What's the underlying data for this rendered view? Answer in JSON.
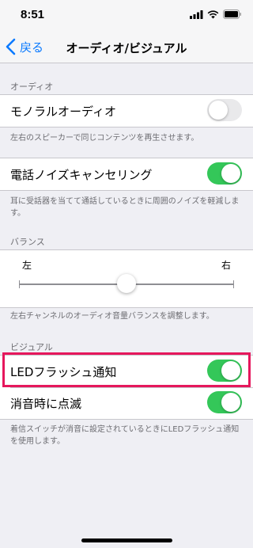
{
  "status_bar": {
    "time": "8:51"
  },
  "nav": {
    "back_label": "戻る",
    "title": "オーディオ/ビジュアル"
  },
  "sections": {
    "audio": {
      "header": "オーディオ",
      "mono_label": "モノラルオーディオ",
      "mono_enabled": false,
      "mono_footer": "左右のスピーカーで同じコンテンツを再生させます。",
      "noise_label": "電話ノイズキャンセリング",
      "noise_enabled": true,
      "noise_footer": "耳に受話器を当てて通話しているときに周囲のノイズを軽減します。"
    },
    "balance": {
      "header": "バランス",
      "left_label": "左",
      "right_label": "右",
      "value": 0.5,
      "footer": "左右チャンネルのオーディオ音量バランスを調整します。"
    },
    "visual": {
      "header": "ビジュアル",
      "led_label": "LEDフラッシュ通知",
      "led_enabled": true,
      "flash_silent_label": "消音時に点滅",
      "flash_silent_enabled": true,
      "footer": "着信スイッチが消音に設定されているときにLEDフラッシュ通知を使用します。"
    }
  },
  "colors": {
    "accent": "#0a7aff",
    "toggle_on": "#34c759",
    "highlight": "#e6175c",
    "background": "#efeff4"
  }
}
